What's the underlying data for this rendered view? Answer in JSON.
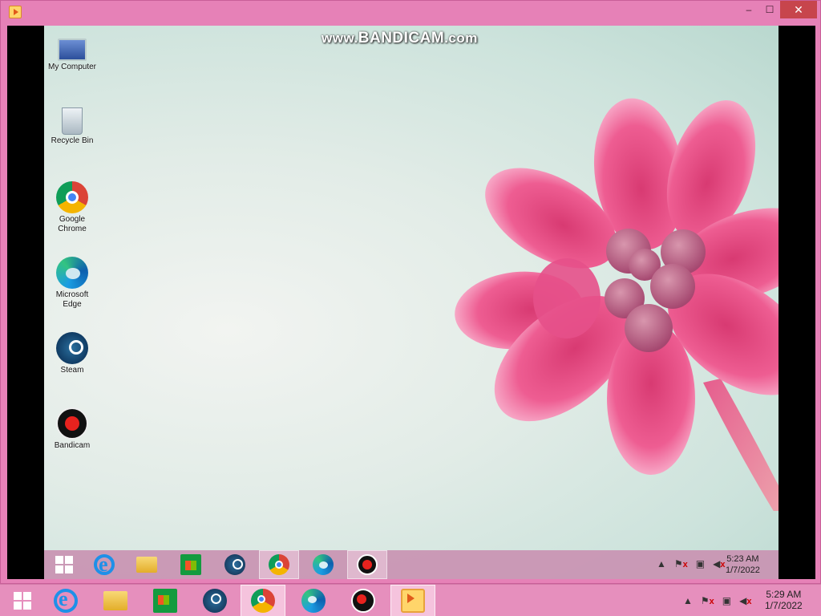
{
  "window": {
    "icon": "bandicam-player-icon",
    "controls": {
      "minimize": "–",
      "maximize": "☐",
      "close": "✕"
    }
  },
  "watermark": {
    "prefix": "www.",
    "brand": "BANDICAM",
    "suffix": ".com"
  },
  "desktop_icons": [
    {
      "label": "My Computer",
      "icon": "computer-icon"
    },
    {
      "label": "Recycle Bin",
      "icon": "recycle-bin-icon"
    },
    {
      "label": "Google Chrome",
      "icon": "chrome-icon"
    },
    {
      "label": "Microsoft Edge",
      "icon": "edge-icon"
    },
    {
      "label": "Steam",
      "icon": "steam-icon"
    },
    {
      "label": "Bandicam",
      "icon": "bandicam-icon"
    }
  ],
  "inner_taskbar": {
    "apps": [
      "start-icon",
      "internet-explorer-icon",
      "file-explorer-icon",
      "store-icon",
      "steam-icon",
      "chrome-icon",
      "edge-icon",
      "bandicam-icon"
    ],
    "active": [
      "chrome-icon",
      "bandicam-icon"
    ],
    "clock": {
      "time": "5:23 AM",
      "date": "1/7/2022"
    }
  },
  "outer_taskbar": {
    "apps": [
      "start-icon",
      "internet-explorer-icon",
      "file-explorer-icon",
      "store-icon",
      "steam-icon",
      "chrome-icon",
      "edge-icon",
      "bandicam-icon",
      "bandicam-player-icon"
    ],
    "active": [
      "chrome-icon",
      "bandicam-player-icon"
    ],
    "clock": {
      "time": "5:29 AM",
      "date": "1/7/2022"
    }
  },
  "tray_icons": [
    "show-hidden-icons-chevron-icon",
    "action-center-flag-icon",
    "network-icon",
    "volume-muted-icon"
  ],
  "colors": {
    "window_frame": "#e681b7",
    "taskbar": "#e68fbd",
    "close_button": "#c7454c",
    "flower_pink": "#e8457f",
    "desktop_bg": "#cde3dc"
  }
}
